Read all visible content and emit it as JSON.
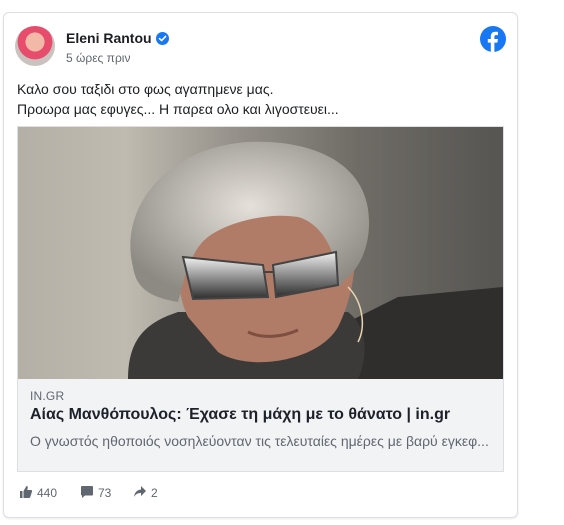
{
  "post": {
    "author": "Eleni Rantou",
    "timestamp": "5 ώρες πριν",
    "text_lines": [
      "Καλο σου ταξιδι στο φως αγαπημενε μας.",
      "Προωρα μας εφυγες... Η παρεα ολο και λιγοστευει..."
    ]
  },
  "link": {
    "domain": "IN.GR",
    "title": "Αίας Μανθόπουλος: Έχασε τη μάχη με το θάνατο | in.gr",
    "description": "Ο γνωστός ηθοποιός νοσηλεύονταν τις τελευταίες ημέρες με βαρύ εγκεφ..."
  },
  "stats": {
    "likes": "440",
    "comments": "73",
    "shares": "2"
  },
  "colors": {
    "facebook_blue": "#1877f2",
    "secondary_text": "#606770"
  },
  "icons": [
    "verified-badge-icon",
    "facebook-logo-icon",
    "like-icon",
    "comment-icon",
    "share-icon"
  ]
}
